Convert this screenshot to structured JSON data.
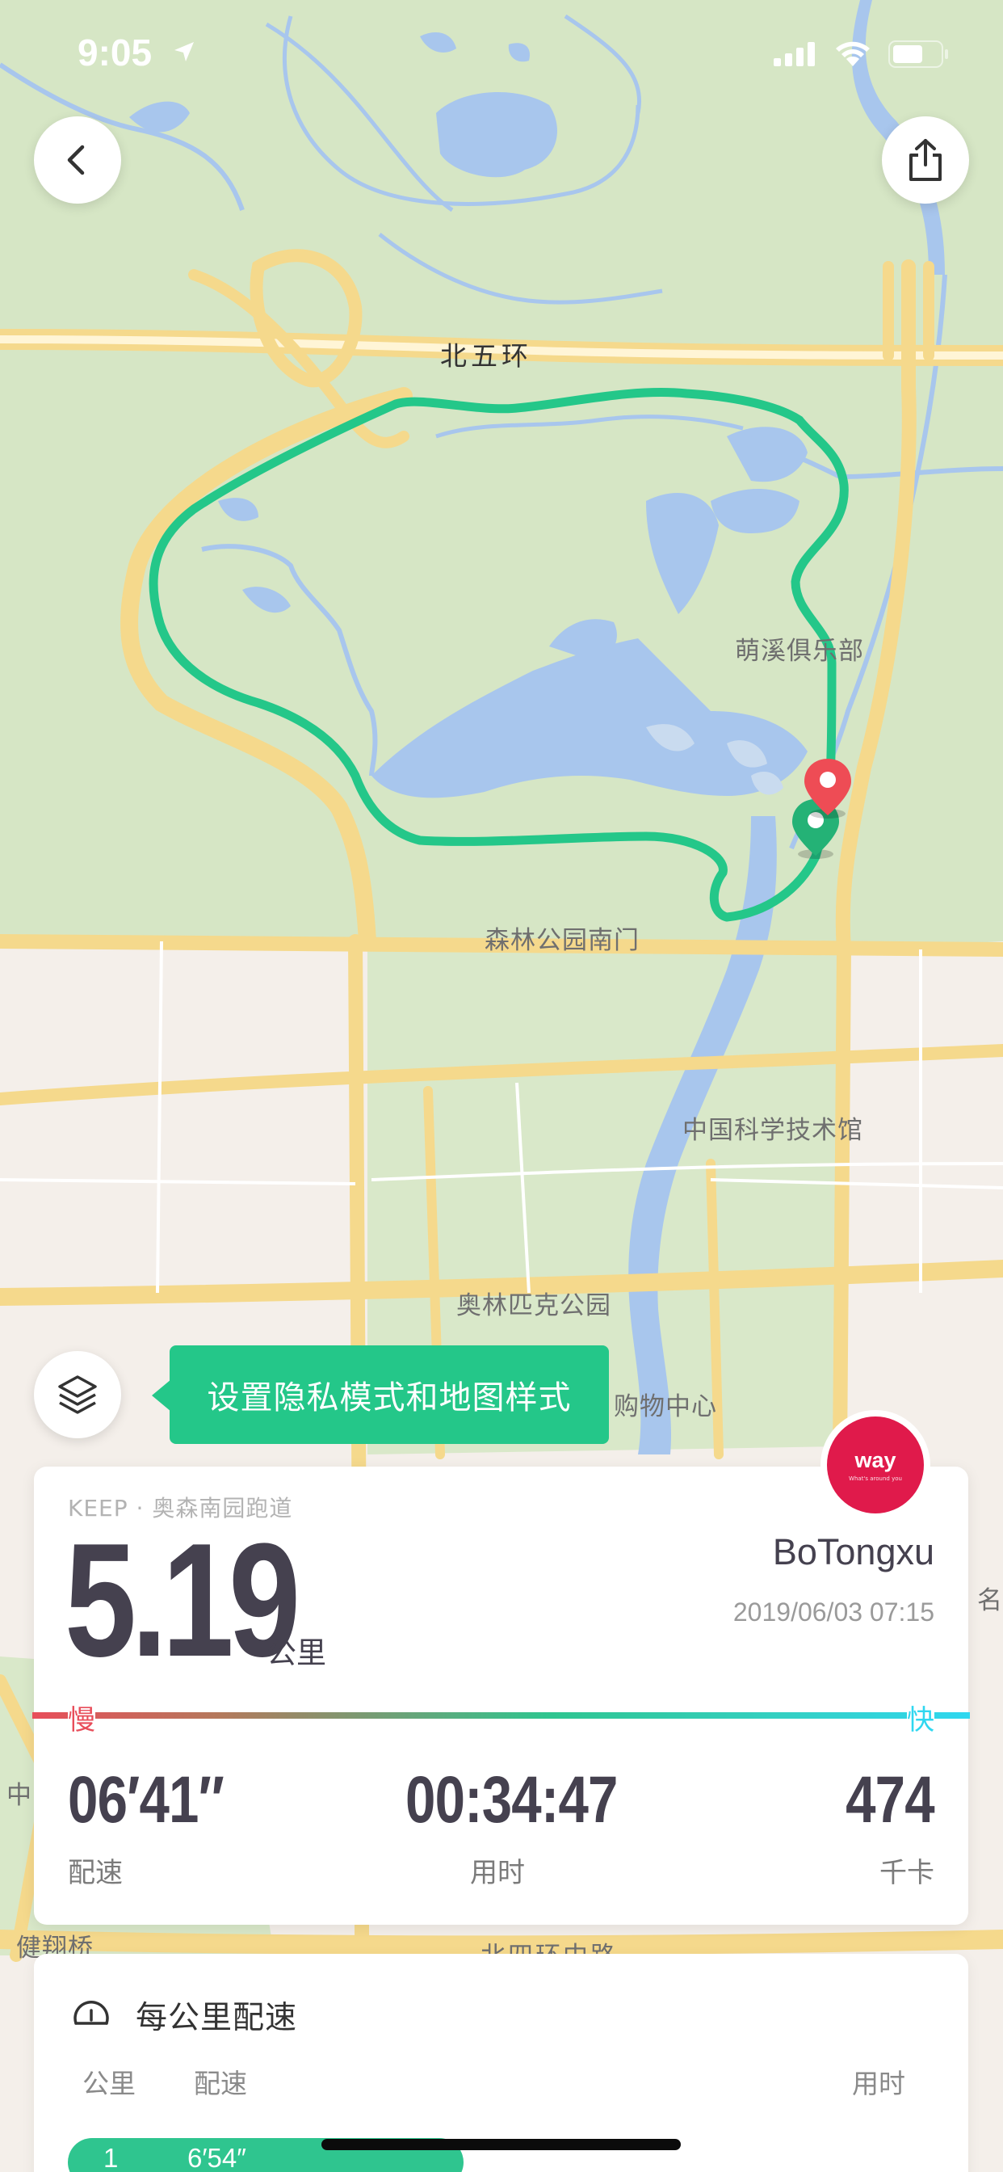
{
  "status_bar": {
    "time": "9:05"
  },
  "map": {
    "labels": {
      "north_5th_ring": "北五环",
      "club": "萌溪俱乐部",
      "south_gate": "森林公园南门",
      "sci_museum": "中国科学技术馆",
      "olympic_park": "奥林匹克公园",
      "shopping_center": "购物中心",
      "jianxiang_bridge": "健翔桥",
      "north_4th_ring": "北四环中路",
      "edge_ming": "名",
      "edge_zhong": "中"
    }
  },
  "tooltip": {
    "text": "设置隐私模式和地图样式"
  },
  "badge": {
    "logo": "way",
    "sub": "What's around you"
  },
  "summary": {
    "route": "KEEP · 奥森南园跑道",
    "distance": "5.19",
    "distance_unit": "公里",
    "username": "BoTongxu",
    "datetime": "2019/06/03 07:15",
    "slow_label": "慢",
    "fast_label": "快",
    "stats": {
      "pace_value": "06′41″",
      "pace_label": "配速",
      "duration_value": "00:34:47",
      "duration_label": "用时",
      "calories_value": "474",
      "calories_label": "千卡"
    }
  },
  "pace_section": {
    "title": "每公里配速",
    "headers": {
      "km": "公里",
      "pace": "配速",
      "time": "用时"
    },
    "rows": [
      {
        "km": "1",
        "pace": "6′54″"
      }
    ]
  },
  "colors": {
    "route": "#24c789",
    "brand": "#e01a4b",
    "water": "#a8c6ed",
    "park": "#d6e6c5"
  }
}
